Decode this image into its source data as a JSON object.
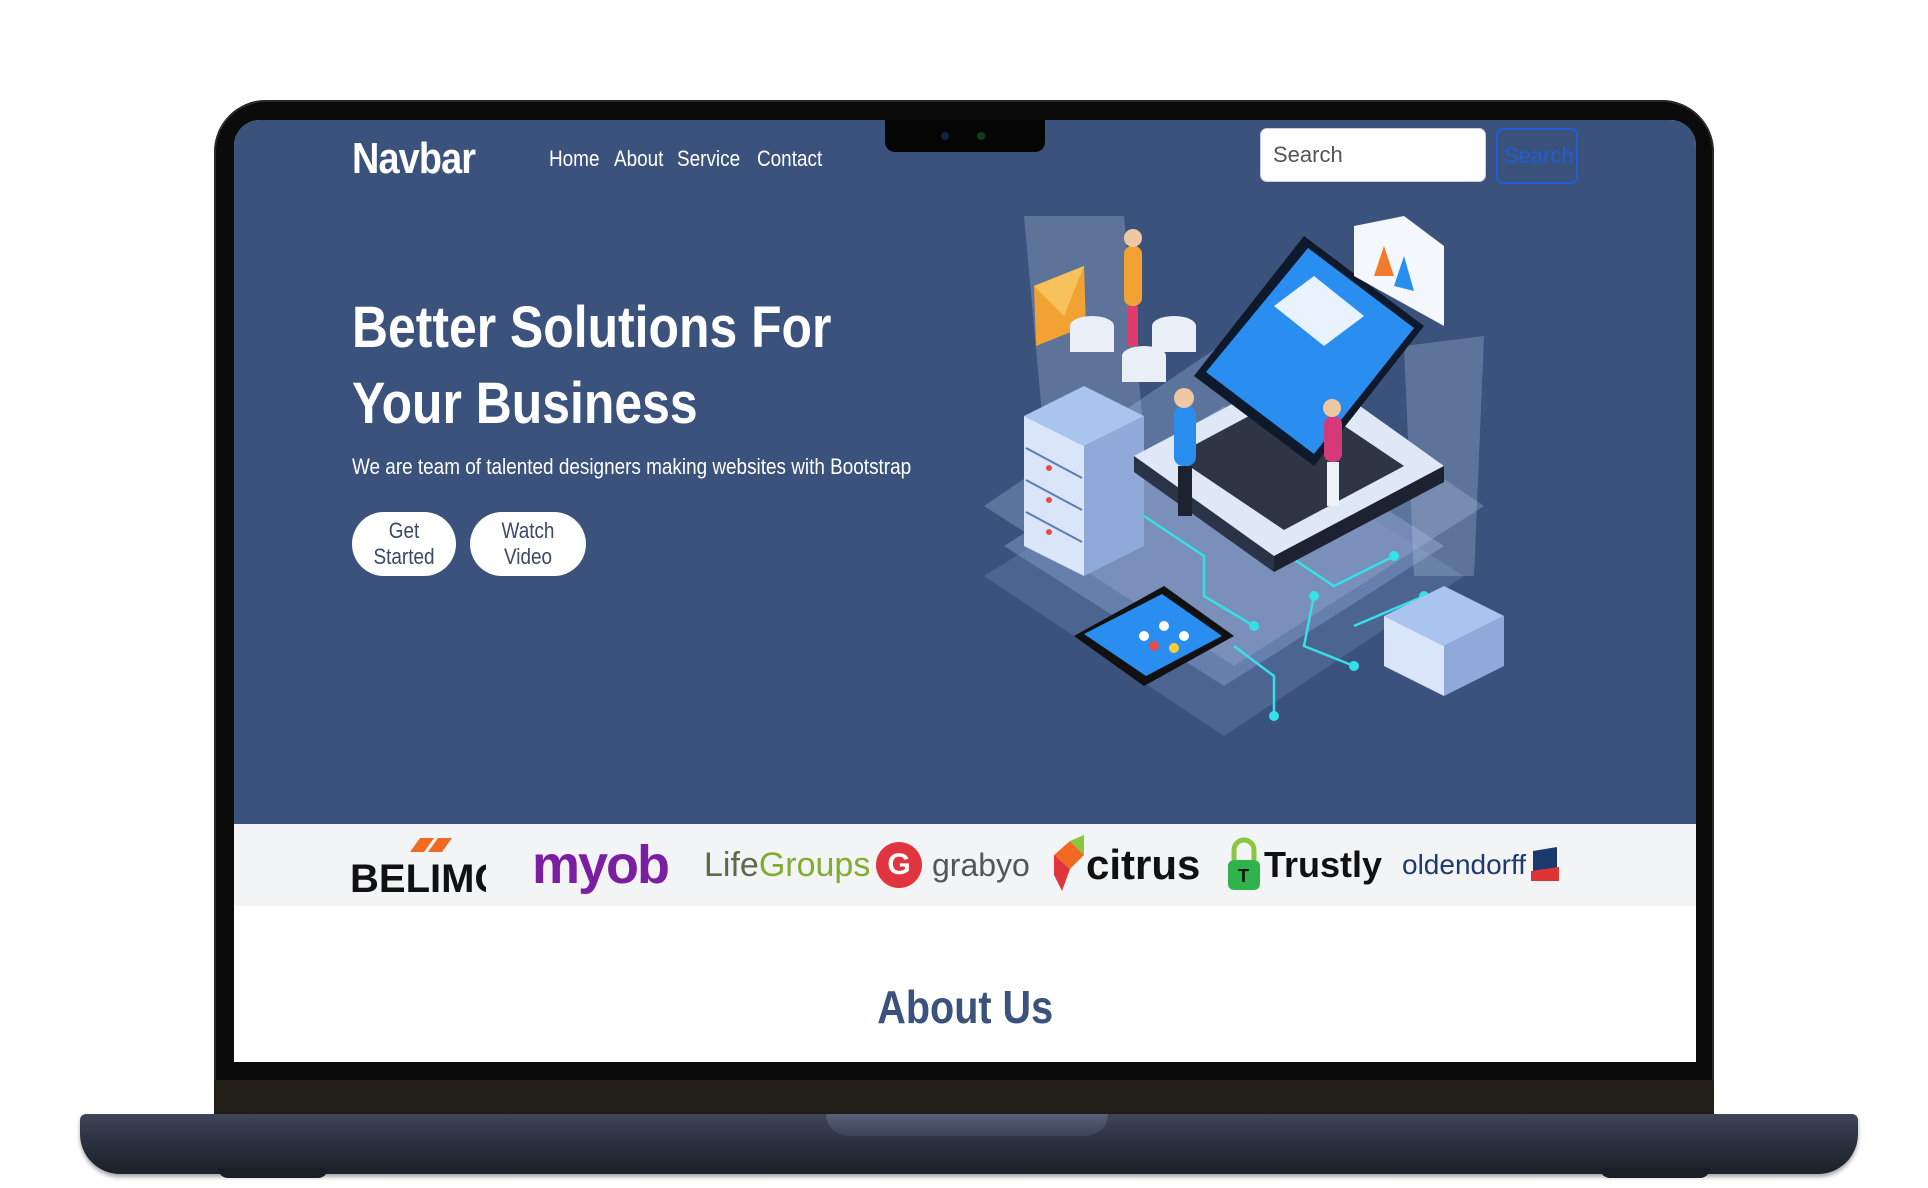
{
  "navbar": {
    "brand": "Navbar",
    "links": [
      "Home",
      "About",
      "Service",
      "Contact"
    ],
    "search_placeholder": "Search",
    "search_button": "Search"
  },
  "hero": {
    "title": "Better Solutions For Your Business",
    "subtitle": "We are team of talented designers making websites with Bootstrap",
    "buttons": {
      "get_started": "Get Started",
      "watch_video": "Watch Video"
    }
  },
  "clients": {
    "belimo": "BELIMO",
    "myob": "myob",
    "lifegroups_life": "Life",
    "lifegroups_groups": "Groups",
    "grabyo": "grabyo",
    "citrus": "citrus",
    "trustly": "Trustly",
    "oldendorff": "oldendorff"
  },
  "about": {
    "title": "About Us"
  },
  "colors": {
    "hero_bg": "#3a527c",
    "accent": "#1e5fd8",
    "logo_strip_bg": "#f3f4f6"
  }
}
